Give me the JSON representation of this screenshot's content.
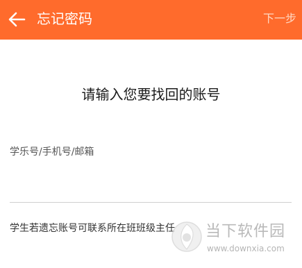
{
  "header": {
    "back_icon": "arrow-left-icon",
    "title": "忘记密码",
    "next_label": "下一步",
    "background": "#ff6b2c"
  },
  "main": {
    "heading": "请输入您要找回的账号",
    "account_field": {
      "placeholder": "学乐号/手机号/邮箱",
      "value": ""
    },
    "hint": "学生若遗忘账号可联系所在班班级主任"
  },
  "watermark": {
    "logo_icon": "downxia-logo-icon",
    "name": "当下软件园",
    "url": "www.downxia.com"
  }
}
